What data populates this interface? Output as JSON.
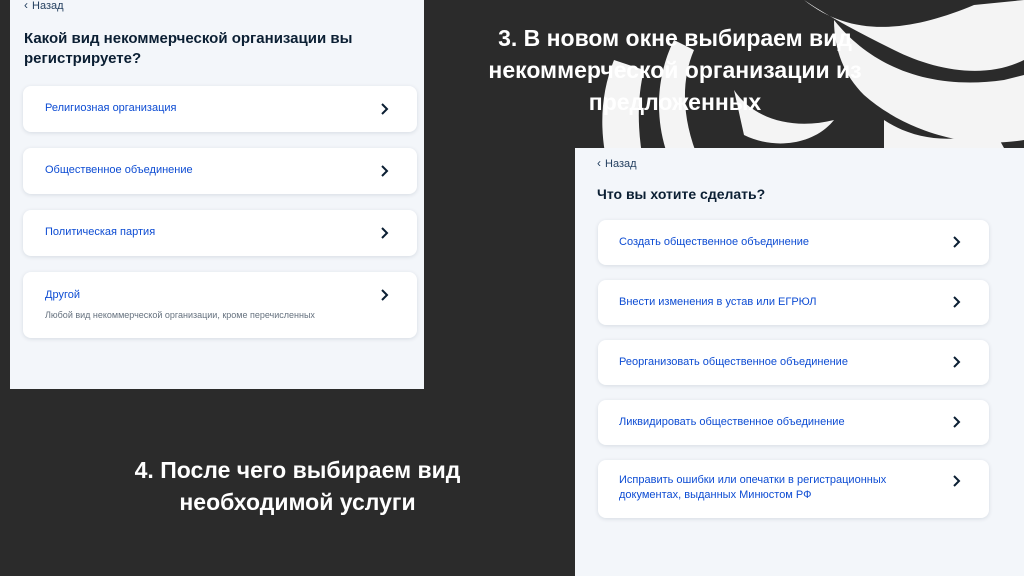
{
  "left_panel": {
    "back_label": "Назад",
    "question": "Какой вид некоммерческой организации вы регистрируете?",
    "options": [
      {
        "label": "Религиозная организация",
        "sub": ""
      },
      {
        "label": "Общественное объединение",
        "sub": ""
      },
      {
        "label": "Политическая партия",
        "sub": ""
      },
      {
        "label": "Другой",
        "sub": "Любой вид некоммерческой организации, кроме перечисленных"
      }
    ]
  },
  "right_panel": {
    "back_label": "Назад",
    "question": "Что вы хотите сделать?",
    "options": [
      {
        "label": "Создать общественное объединение"
      },
      {
        "label": "Внести изменения в устав или ЕГРЮЛ"
      },
      {
        "label": "Реорганизовать общественное объединение"
      },
      {
        "label": "Ликвидировать общественное объединение"
      },
      {
        "label": "Исправить ошибки или опечатки в регистрационных документах, выданных Минюстом РФ"
      }
    ]
  },
  "captions": {
    "step3": "3. В новом окне выбираем вид некоммерческой организации из предложенных",
    "step4": "4. После чего выбираем вид необходимой услуги"
  },
  "colors": {
    "background": "#2b2b2b",
    "link": "#0d4cd3",
    "panel": "#f3f6fa"
  },
  "icons": {
    "emblem": "eagle-emblem-icon",
    "back": "chevron-left-icon",
    "arrow": "chevron-right-icon"
  }
}
